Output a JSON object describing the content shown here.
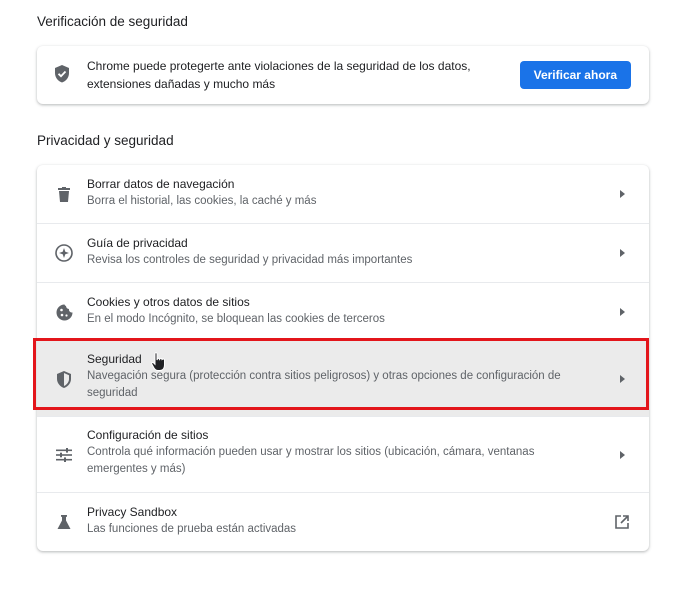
{
  "safety_check": {
    "heading": "Verificación de seguridad",
    "description": "Chrome puede protegerte ante violaciones de la seguridad de los datos, extensiones dañadas y mucho más",
    "button_label": "Verificar ahora",
    "icon": "shield-check-icon"
  },
  "privacy": {
    "heading": "Privacidad y seguridad",
    "items": [
      {
        "title": "Borrar datos de navegación",
        "subtitle": "Borra el historial, las cookies, la caché y más",
        "icon": "trash-icon"
      },
      {
        "title": "Guía de privacidad",
        "subtitle": "Revisa los controles de seguridad y privacidad más importantes",
        "icon": "compass-icon"
      },
      {
        "title": "Cookies y otros datos de sitios",
        "subtitle": "En el modo Incógnito, se bloquean las cookies de terceros",
        "icon": "cookie-icon"
      },
      {
        "title": "Seguridad",
        "subtitle": "Navegación segura (protección contra sitios peligrosos) y otras opciones de configuración de seguridad",
        "icon": "shield-icon"
      },
      {
        "title": "Configuración de sitios",
        "subtitle": "Controla qué información pueden usar y mostrar los sitios (ubicación, cámara, ventanas emergentes y más)",
        "icon": "sliders-icon"
      },
      {
        "title": "Privacy Sandbox",
        "subtitle": "Las funciones de prueba están activadas",
        "icon": "flask-icon"
      }
    ]
  },
  "colors": {
    "accent": "#1a73e8",
    "highlight_border": "#e3151b",
    "hover_row": "#ebebeb"
  }
}
